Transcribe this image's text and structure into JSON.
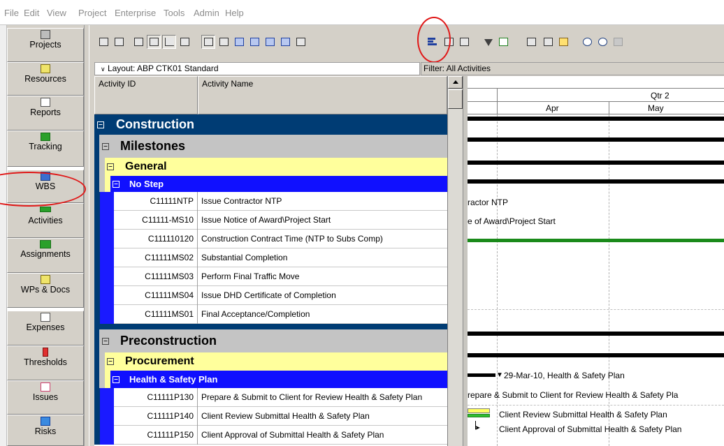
{
  "menu": [
    "File",
    "Edit",
    "View",
    "Project",
    "Enterprise",
    "Tools",
    "Admin",
    "Help"
  ],
  "sidebar": {
    "items": [
      {
        "label": "Projects",
        "icon": "folder-icon"
      },
      {
        "label": "Resources",
        "icon": "person-icon"
      },
      {
        "label": "Reports",
        "icon": "report-icon"
      },
      {
        "label": "Tracking",
        "icon": "chart-icon"
      },
      {
        "label": "WBS",
        "icon": "wbs-icon"
      },
      {
        "label": "Activities",
        "icon": "activity-bar-icon"
      },
      {
        "label": "Assignments",
        "icon": "assignments-icon"
      },
      {
        "label": "WPs & Docs",
        "icon": "document-icon"
      },
      {
        "label": "Expenses",
        "icon": "calculator-icon"
      },
      {
        "label": "Thresholds",
        "icon": "threshold-icon"
      },
      {
        "label": "Issues",
        "icon": "issues-icon"
      },
      {
        "label": "Risks",
        "icon": "risks-icon"
      }
    ]
  },
  "layout": {
    "label": "Layout: ABP CTK01 Standard"
  },
  "filter": {
    "label": "Filter: All Activities"
  },
  "columns": {
    "activity_id": "Activity ID",
    "activity_name": "Activity Name"
  },
  "timescale": {
    "quarter": "Qtr 2",
    "months": [
      "Apr",
      "May"
    ]
  },
  "groups": {
    "construction": "Construction",
    "milestones": "Milestones",
    "general": "General",
    "no_step": "No Step",
    "preconstruction": "Preconstruction",
    "procurement": "Procurement",
    "health_safety": "Health & Safety Plan"
  },
  "activities": [
    {
      "id": "C11111NTP",
      "name": "Issue Contractor NTP"
    },
    {
      "id": "C11111-MS10",
      "name": "Issue Notice of Award\\Project Start"
    },
    {
      "id": "C111110120",
      "name": "Construction Contract Time (NTP to Subs Comp)"
    },
    {
      "id": "C11111MS02",
      "name": "Substantial Completion"
    },
    {
      "id": "C11111MS03",
      "name": "Perform Final Traffic Move"
    },
    {
      "id": "C11111MS04",
      "name": "Issue DHD Certificate of Completion"
    },
    {
      "id": "C11111MS01",
      "name": "Final Acceptance/Completion"
    },
    {
      "id": "C11111P130",
      "name": "Prepare & Submit to Client for Review Health & Safety Plan"
    },
    {
      "id": "C11111P140",
      "name": "Client Review Submittal Health & Safety Plan"
    },
    {
      "id": "C11111P150",
      "name": "Client Approval of Submittal Health & Safety Plan"
    }
  ],
  "gantt_labels": {
    "ntp": "ractor NTP",
    "award": "e of Award\\Project Start",
    "hs_summary": "29-Mar-10, Health & Safety Plan",
    "p130": "repare & Submit to Client for Review Health & Safety Pla",
    "p140": "Client Review Submittal Health & Safety Plan",
    "p150": "Client Approval of Submittal Health & Safety Plan"
  },
  "colors": {
    "wbs_construction": "#003c74",
    "wbs_milestones": "#c4c4c4",
    "wbs_general": "#ffff9c",
    "wbs_nostep": "#0000ff",
    "callout": "#e01818",
    "activity_bar": "#1a8a1a"
  }
}
